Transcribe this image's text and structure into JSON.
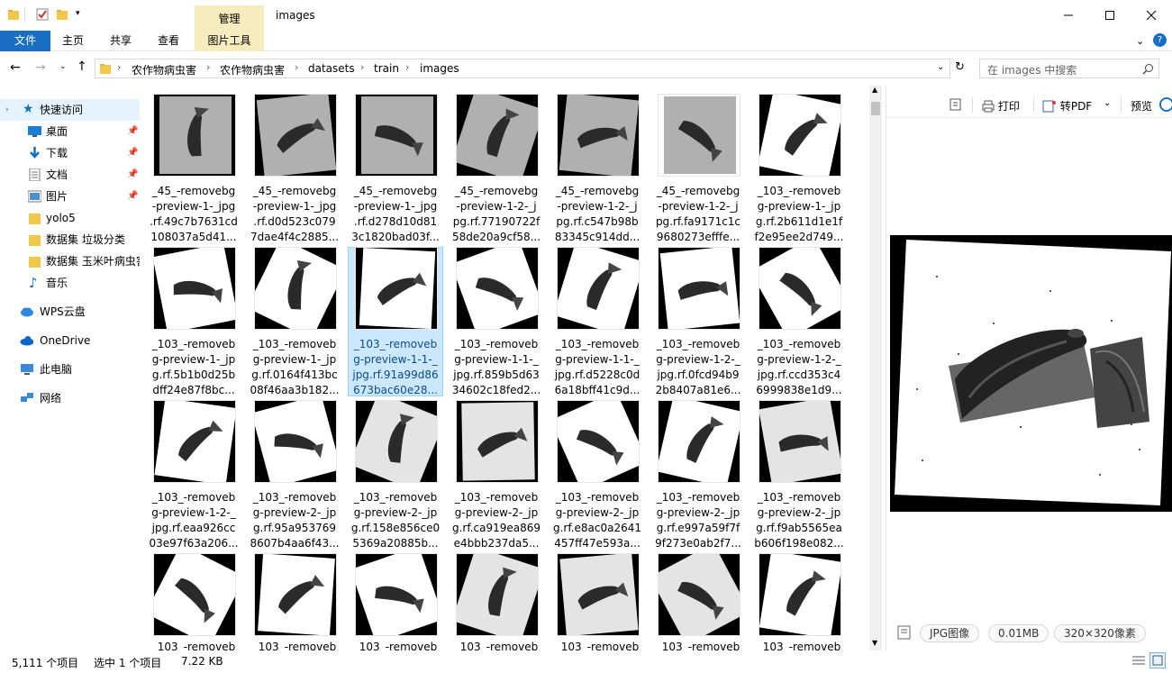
{
  "window": {
    "title": "images",
    "context_tab": "管理",
    "controls": [
      "minimize-icon",
      "maximize-icon",
      "close-icon"
    ]
  },
  "ribbon": {
    "tabs": [
      "文件",
      "主页",
      "共享",
      "查看",
      "图片工具"
    ]
  },
  "address": {
    "breadcrumbs": [
      "农作物病虫害",
      "农作物病虫害",
      "datasets",
      "train",
      "images"
    ],
    "search_placeholder": "在 images 中搜索"
  },
  "sidebar": {
    "items": [
      {
        "label": "快速访问",
        "icon": "star-icon",
        "selected": true
      },
      {
        "label": "桌面",
        "icon": "desktop-icon",
        "pinned": true
      },
      {
        "label": "下载",
        "icon": "download-icon",
        "pinned": true
      },
      {
        "label": "文档",
        "icon": "document-icon",
        "pinned": true
      },
      {
        "label": "图片",
        "icon": "pictures-icon",
        "pinned": true
      },
      {
        "label": "yolo5",
        "icon": "folder-icon"
      },
      {
        "label": "数据集 垃圾分类",
        "icon": "folder-icon"
      },
      {
        "label": "数据集 玉米叶病虫害",
        "icon": "folder-icon"
      },
      {
        "label": "音乐",
        "icon": "music-icon"
      },
      {
        "label": "WPS云盘",
        "icon": "cloud-icon"
      },
      {
        "label": "OneDrive",
        "icon": "onedrive-icon"
      },
      {
        "label": "此电脑",
        "icon": "computer-icon"
      },
      {
        "label": "网络",
        "icon": "network-icon"
      }
    ]
  },
  "files": [
    {
      "lines": [
        "_45_-removebg",
        "-preview-1-_jpg",
        ".rf.49c7b7631cd",
        "108037a5d41..."
      ]
    },
    {
      "lines": [
        "_45_-removebg",
        "-preview-1-_jpg",
        ".rf.d0d523c079",
        "7dae4f4c2885..."
      ]
    },
    {
      "lines": [
        "_45_-removebg",
        "-preview-1-_jpg",
        ".rf.d278d10d81",
        "3c1820bad03f..."
      ]
    },
    {
      "lines": [
        "_45_-removebg",
        "-preview-1-2-_j",
        "pg.rf.77190722f",
        "58de20a9cf58..."
      ]
    },
    {
      "lines": [
        "_45_-removebg",
        "-preview-1-2-_j",
        "pg.rf.c547b98b",
        "83345c914dd..."
      ]
    },
    {
      "lines": [
        "_45_-removebg",
        "-preview-1-2-_j",
        "pg.rf.fa9171c1c",
        "9680273efffe..."
      ]
    },
    {
      "lines": [
        "_103_-removeb",
        "g-preview-1-_jp",
        "g.rf.2b611d1e1f",
        "f2e95ee2d749..."
      ]
    },
    {
      "lines": [
        "_103_-removeb",
        "g-preview-1-_jp",
        "g.rf.5b1b0d25b",
        "dff24e87f8bc..."
      ]
    },
    {
      "lines": [
        "_103_-removeb",
        "g-preview-1-_jp",
        "g.rf.0164f413bc",
        "08f46aa3b182..."
      ]
    },
    {
      "lines": [
        "_103_-removeb",
        "g-preview-1-1-_",
        "jpg.rf.91a99d86",
        "673bac60e28..."
      ],
      "selected": true
    },
    {
      "lines": [
        "_103_-removeb",
        "g-preview-1-1-_",
        "jpg.rf.859b5d63",
        "34602c18fed2..."
      ]
    },
    {
      "lines": [
        "_103_-removeb",
        "g-preview-1-1-_",
        "jpg.rf.d5228c0d",
        "6a18bff41c9d..."
      ]
    },
    {
      "lines": [
        "_103_-removeb",
        "g-preview-1-2-_",
        "jpg.rf.0fcd94b9",
        "2b8407a81e6..."
      ]
    },
    {
      "lines": [
        "_103_-removeb",
        "g-preview-1-2-_",
        "jpg.rf.ccd353c4",
        "6999838e1d9..."
      ]
    },
    {
      "lines": [
        "_103_-removeb",
        "g-preview-1-2-_",
        "jpg.rf.eaa926cc",
        "03e97f63a206..."
      ]
    },
    {
      "lines": [
        "_103_-removeb",
        "g-preview-2-_jp",
        "g.rf.95a953769",
        "8607b4aa6f43..."
      ]
    },
    {
      "lines": [
        "_103_-removeb",
        "g-preview-2-_jp",
        "g.rf.158e856ce0",
        "5369a20885b..."
      ]
    },
    {
      "lines": [
        "_103_-removeb",
        "g-preview-2-_jp",
        "g.rf.ca919ea869",
        "e4bbb237da5..."
      ]
    },
    {
      "lines": [
        "_103_-removeb",
        "g-preview-2-_jp",
        "g.rf.e8ac0a2641",
        "457ff47e593a..."
      ]
    },
    {
      "lines": [
        "_103_-removeb",
        "g-preview-2-_jp",
        "g.rf.e997a59f7f",
        "9f273e0ab2f7..."
      ]
    },
    {
      "lines": [
        "_103_-removeb",
        "g-preview-2-_jp",
        "g.rf.f9ab5565ea",
        "b606f198e082..."
      ]
    },
    {
      "lines": [
        "_103_-removeb"
      ]
    },
    {
      "lines": [
        "_103_-removeb"
      ]
    },
    {
      "lines": [
        "_103_-removeb"
      ]
    },
    {
      "lines": [
        "_103_-removeb"
      ]
    },
    {
      "lines": [
        "_103_-removeb"
      ]
    },
    {
      "lines": [
        "_103_-removeb"
      ]
    },
    {
      "lines": [
        "_103_-removeb"
      ]
    }
  ],
  "preview": {
    "tools": {
      "print": "打印",
      "to_pdf": "转PDF",
      "preview": "预览"
    },
    "info": {
      "type": "JPG图像",
      "size": "0.01MB",
      "dimensions": "320×320像素"
    }
  },
  "status": {
    "count": "5,111 个项目",
    "selected": "选中 1 个项目",
    "size": "7.22 KB"
  },
  "colors": {
    "accent": "#1a6fc4",
    "selection": "#cce8ff",
    "context_tab": "#f7ecbd"
  }
}
